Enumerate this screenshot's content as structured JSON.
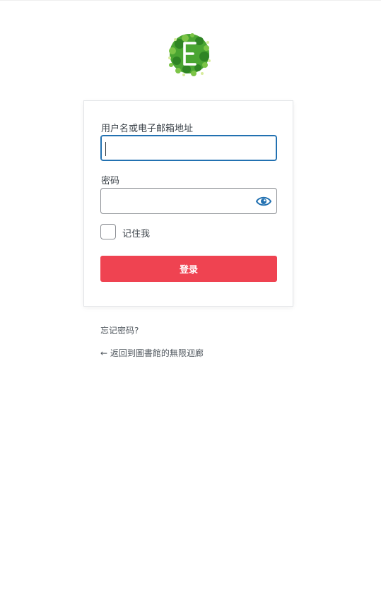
{
  "brand": {
    "logo_icon": "e-leaf-logo-icon",
    "logo_letter": "E"
  },
  "form": {
    "username_label": "用户名或电子邮箱地址",
    "username_value": "",
    "password_label": "密码",
    "password_value": "",
    "show_password_icon": "eye-icon",
    "remember_label": "记住我",
    "remember_checked": false,
    "submit_label": "登录"
  },
  "links": {
    "lost_password": "忘记密码?",
    "back_to_site": "← 返回到圖書館的無限迴廊"
  },
  "colors": {
    "primary_button": "#ef4351",
    "focus_border": "#2271b1",
    "eye_icon": "#2271b1",
    "logo_green": "#3f9a2f"
  }
}
